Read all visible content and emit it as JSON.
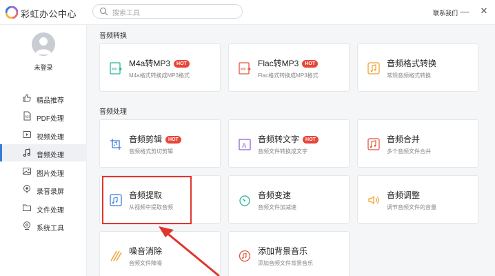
{
  "app": {
    "title": "彩虹办公中心"
  },
  "search": {
    "placeholder": "搜索工具"
  },
  "header": {
    "contact": "联系我们",
    "minimize": "—",
    "close": "✕"
  },
  "user": {
    "name": "未登录"
  },
  "sidebar": {
    "items": [
      {
        "label": "精品推荐",
        "icon": "thumbs-up-icon"
      },
      {
        "label": "PDF处理",
        "icon": "pdf-file-icon"
      },
      {
        "label": "视频处理",
        "icon": "video-play-icon"
      },
      {
        "label": "音频处理",
        "icon": "music-note-icon",
        "active": true
      },
      {
        "label": "图片处理",
        "icon": "image-icon"
      },
      {
        "label": "录音录屏",
        "icon": "record-icon"
      },
      {
        "label": "文件处理",
        "icon": "folder-icon"
      },
      {
        "label": "系统工具",
        "icon": "system-tools-icon"
      }
    ]
  },
  "sections": [
    {
      "title": "音频转换",
      "cards": [
        {
          "title": "M4a转MP3",
          "desc": "M4a格式转换成MP3格式",
          "hot": "HOT",
          "icon": "m4a-convert-icon"
        },
        {
          "title": "Flac转MP3",
          "desc": "Flac格式转换成MP3格式",
          "hot": "HOT",
          "icon": "flac-convert-icon"
        },
        {
          "title": "音频格式转换",
          "desc": "常规音频格式转换",
          "icon": "audio-format-icon"
        }
      ]
    },
    {
      "title": "音频处理",
      "cards": [
        {
          "title": "音频剪辑",
          "desc": "音频格式剪切剪辑",
          "hot": "HOT",
          "icon": "audio-cut-icon"
        },
        {
          "title": "音频转文字",
          "desc": "音频文件转换成文字",
          "hot": "HOT",
          "icon": "audio-to-text-icon"
        },
        {
          "title": "音频合并",
          "desc": "多个音频文件合并",
          "icon": "audio-merge-icon"
        },
        {
          "title": "音频提取",
          "desc": "从视频中提取音频",
          "icon": "audio-extract-icon"
        },
        {
          "title": "音频变速",
          "desc": "音频文件加减速",
          "icon": "audio-speed-icon"
        },
        {
          "title": "音频调整",
          "desc": "调节音频文件的音量",
          "icon": "volume-icon"
        },
        {
          "title": "噪音消除",
          "desc": "音频文件降噪",
          "icon": "noise-removal-icon"
        },
        {
          "title": "添加背景音乐",
          "desc": "添加音频文件背景音乐",
          "icon": "background-music-icon"
        }
      ]
    }
  ],
  "colors": {
    "accent": "#3a7bd5",
    "hot": "#e9463a",
    "highlight": "#e0352b",
    "icon_orange": "#f0a030",
    "icon_teal": "#2bb39a",
    "icon_purple": "#8a63d2",
    "icon_red": "#e0563b"
  }
}
